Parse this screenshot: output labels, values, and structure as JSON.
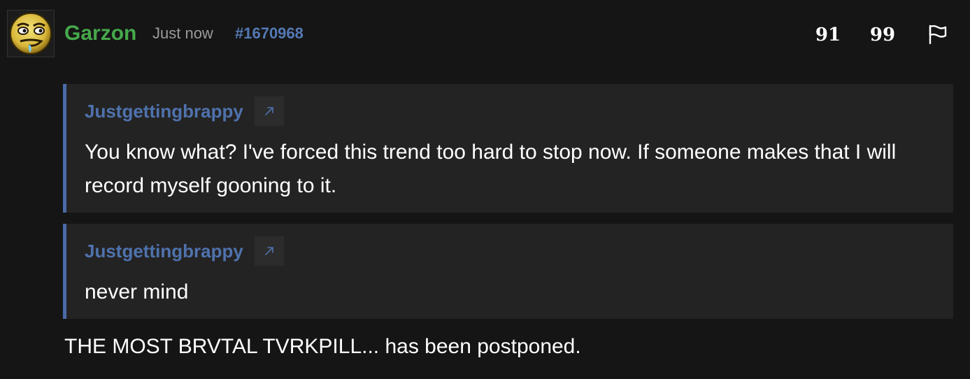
{
  "post": {
    "username": "Garzon",
    "timestamp": "Just now",
    "post_id": "#1670968",
    "avatar_icon": "smug-face-emoji-avatar",
    "actions": [
      {
        "name": "reply-quote-icon",
        "label": "91"
      },
      {
        "name": "quote-icon",
        "label": "99"
      },
      {
        "name": "flag-icon",
        "label": ""
      }
    ],
    "quotes": [
      {
        "author": "Justgettingbrappy",
        "jump_icon": "arrow-up-right-icon",
        "text": "You know what? I've forced this trend too hard to stop now. If someone makes that I will record myself gooning to it."
      },
      {
        "author": "Justgettingbrappy",
        "jump_icon": "arrow-up-right-icon",
        "text": "never mind"
      }
    ],
    "body": "THE MOST BRVTAL TVRKPILL... has been postponed."
  },
  "colors": {
    "background": "#151515",
    "quote_background": "#232323",
    "quote_border": "#4a6aa8",
    "username": "#46a84b",
    "link": "#5479b5",
    "text": "#ffffff",
    "muted": "#9a9a9a"
  }
}
